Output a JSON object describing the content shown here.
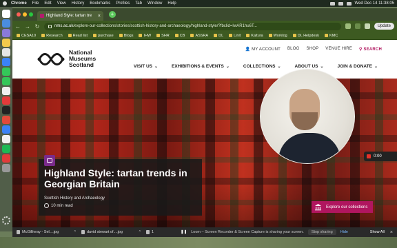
{
  "menubar": {
    "app": "Chrome",
    "menus": [
      "File",
      "Edit",
      "View",
      "History",
      "Bookmarks",
      "Profiles",
      "Tab",
      "Window",
      "Help"
    ],
    "datetime": "Wed Dec 14  11:38:05"
  },
  "browser": {
    "tab_title": "Highland Style: tartan tre",
    "url_host": "nms.ac.uk",
    "url_path": "/explore-our-collections/stories/scottish-history-and-archaeology/highland-style/?fbclid=IwAR1hu6T...",
    "update_label": "Update",
    "bookmarks": [
      "CESA10",
      "Research",
      "Read list",
      "purchase",
      "Blogs",
      "IHW",
      "SHR",
      "CB",
      "ASSRA",
      "DL",
      "Linit",
      "Kaltura",
      "Worklog",
      "DL Helpdesk",
      "KMC"
    ]
  },
  "site": {
    "logo_lines": [
      "National",
      "Museums",
      "Scotland"
    ],
    "utility": [
      "MY ACCOUNT",
      "BLOG",
      "SHOP",
      "VENUE HIRE",
      "SEARCH"
    ],
    "nav": [
      "VISIT US",
      "EXHIBITIONS & EVENTS",
      "COLLECTIONS",
      "ABOUT US",
      "JOIN & DONATE"
    ]
  },
  "hero": {
    "title": "Highland Style: tartan trends in Georgian Britain",
    "category": "Scottish History and Archaeology",
    "read_time": "10 min read",
    "explore_label": "Explore our collections"
  },
  "recorder": {
    "time": "0:00"
  },
  "downloads": {
    "files": [
      "McGillivray - Sel....jpg",
      "david stewart of....jpg",
      "1"
    ],
    "sharing_text": "Loom – Screen Recorder & Screen Capture is sharing your screen.",
    "stop_label": "Stop sharing",
    "hide_label": "Hide",
    "show_all": "Show All"
  },
  "colors": {
    "brand": "#b0165f",
    "browser_green": "#3d5a21",
    "title_card": "#191919"
  }
}
